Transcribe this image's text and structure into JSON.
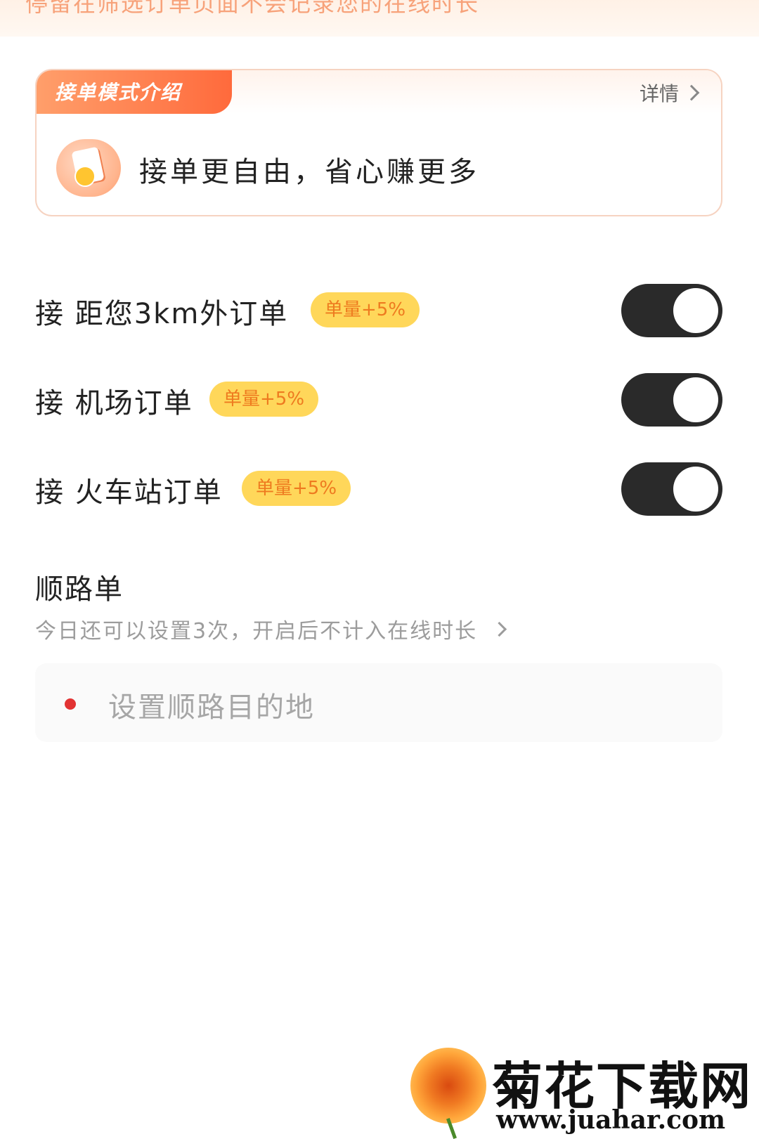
{
  "top_banner": {
    "text": "停留在筛选订单页面不会记录您的在线时长"
  },
  "intro_card": {
    "tag": "接单模式介绍",
    "detail_label": "详情",
    "headline": "接单更自由，省心赚更多"
  },
  "settings": [
    {
      "label": "接 距您3km外订单",
      "badge": "单量+5%",
      "enabled": true
    },
    {
      "label": "接 机场订单",
      "badge": "单量+5%",
      "enabled": true
    },
    {
      "label": "接 火车站订单",
      "badge": "单量+5%",
      "enabled": true
    }
  ],
  "route_order": {
    "title": "顺路单",
    "subtitle": "今日还可以设置3次，开启后不计入在线时长",
    "destination_placeholder": "设置顺路目的地"
  },
  "watermark": {
    "title": "菊花下载网",
    "url": "www.juahar.com"
  },
  "colors": {
    "accent": "#ff6a3c",
    "badge_bg": "#ffd75a",
    "badge_text": "#ee7a1f",
    "toggle_on": "#2a2a2a",
    "dot": "#e23333"
  }
}
